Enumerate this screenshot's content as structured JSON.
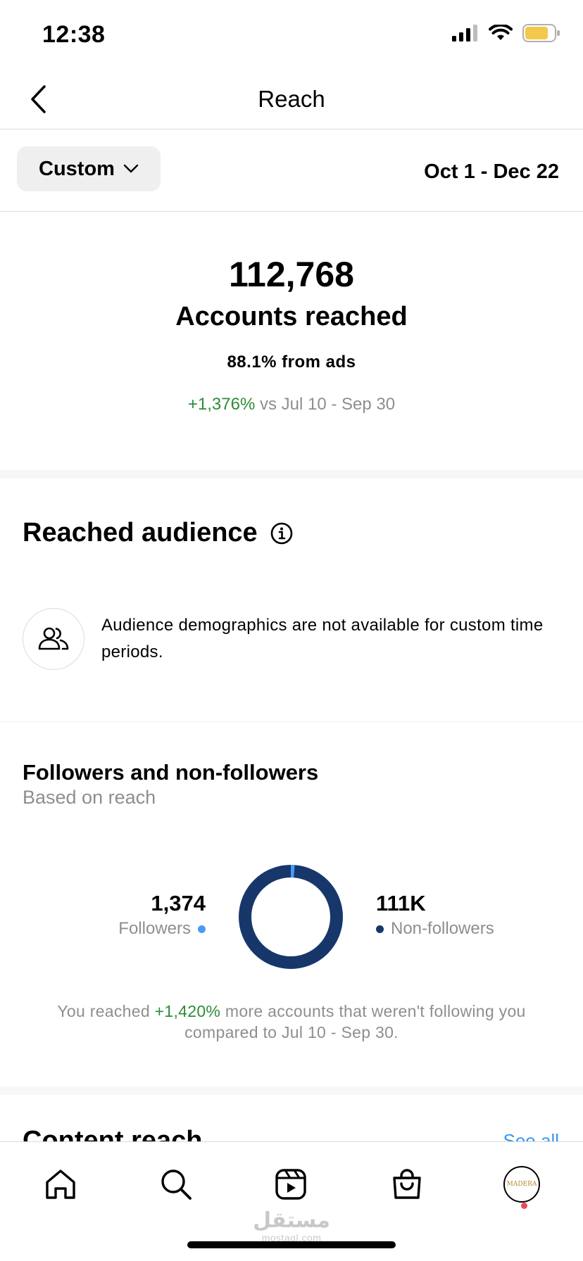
{
  "status_bar": {
    "time": "12:38"
  },
  "header": {
    "title": "Reach"
  },
  "filter": {
    "period_label": "Custom",
    "date_range": "Oct 1 - Dec 22"
  },
  "summary": {
    "accounts_reached": "112,768",
    "accounts_reached_label": "Accounts reached",
    "ads_share": "88.1% from ads",
    "change": "+1,376%",
    "compare_text": "vs Jul 10 - Sep 30"
  },
  "reached_audience": {
    "title": "Reached audience",
    "notice": "Audience demographics are not available for custom time periods."
  },
  "followers_split": {
    "title": "Followers and non-followers",
    "subtitle": "Based on reach",
    "followers_count": "1,374",
    "followers_label": "Followers",
    "non_followers_count": "111K",
    "non_followers_label": "Non-followers",
    "note_prefix": "You reached ",
    "note_change": "+1,420%",
    "note_suffix": " more accounts that weren't following you compared to Jul 10 - Sep 30.",
    "followers_fraction": 0.012,
    "colors": {
      "followers": "#4a9af5",
      "non_followers": "#17376b"
    }
  },
  "next_section": {
    "title": "Content reach",
    "link": "See all"
  },
  "tab_bar": {
    "items": [
      "home-icon",
      "search-icon",
      "reels-icon",
      "shop-icon",
      "profile-avatar"
    ],
    "avatar_text": "MADERA"
  },
  "watermark": {
    "arabic": "مستقل",
    "latin": "mostaql.com"
  }
}
